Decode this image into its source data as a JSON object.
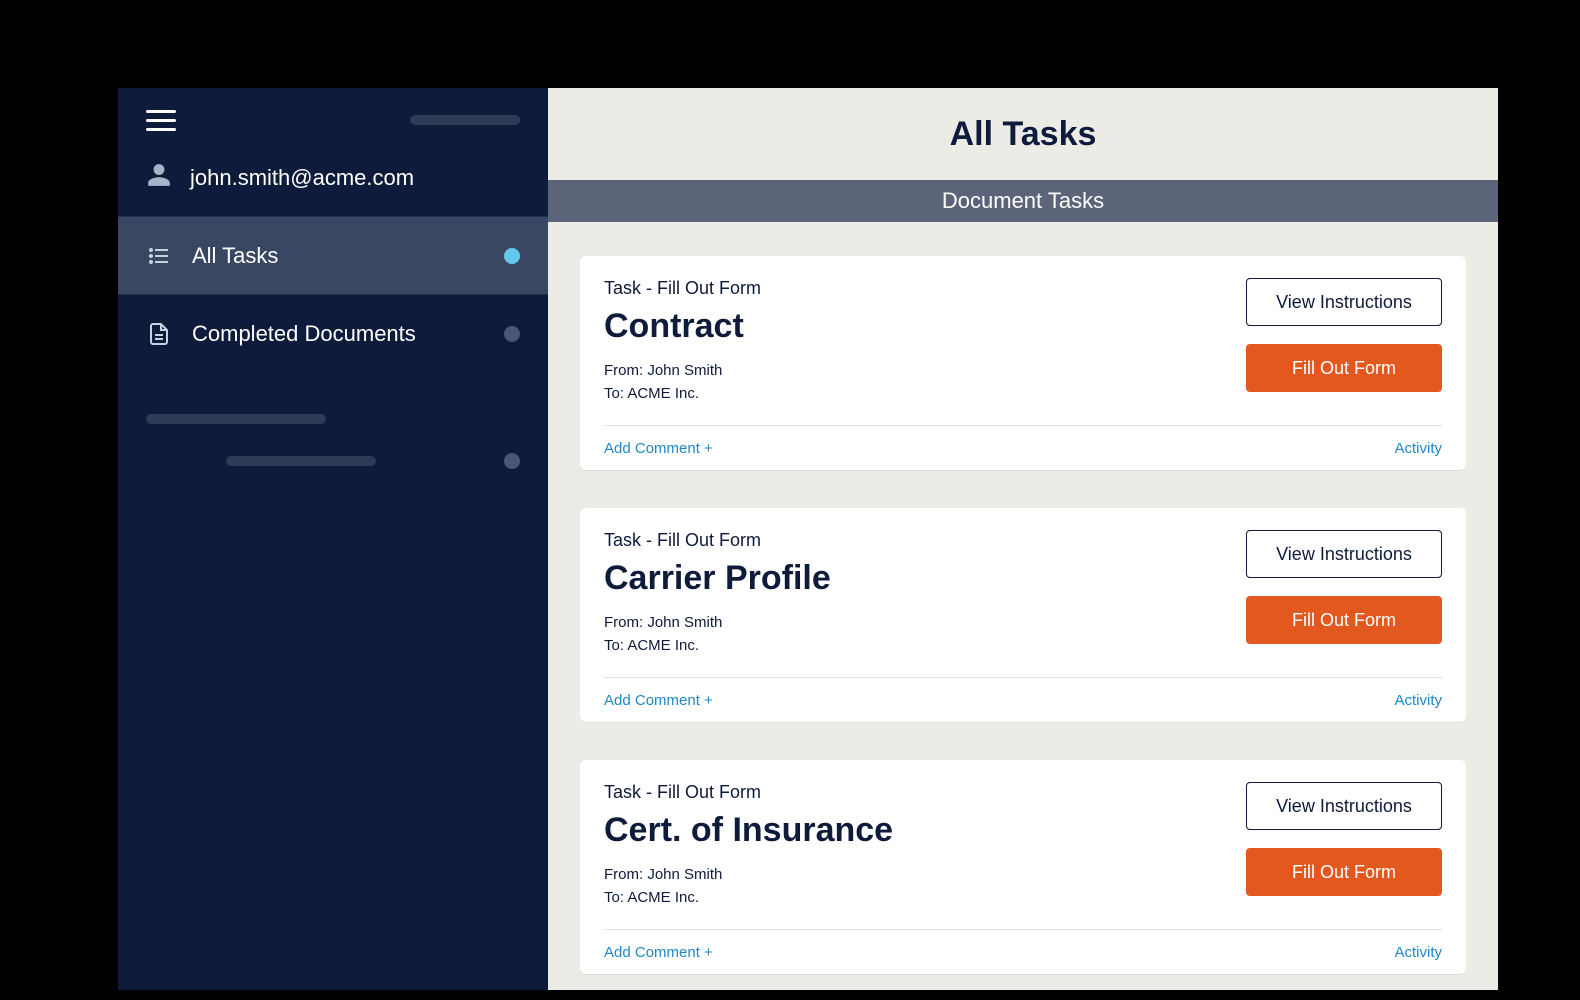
{
  "sidebar": {
    "user_email": "john.smith@acme.com",
    "items": [
      {
        "label": "All Tasks",
        "active": true,
        "dot": "blue"
      },
      {
        "label": "Completed Documents",
        "active": false,
        "dot": "gray"
      }
    ]
  },
  "main": {
    "title": "All Tasks",
    "section": "Document Tasks",
    "buttons": {
      "view_instructions": "View Instructions",
      "fill_out_form": "Fill Out Form"
    },
    "footer": {
      "add_comment": "Add Comment +",
      "activity": "Activity"
    },
    "tasks": [
      {
        "label": "Task - Fill Out Form",
        "title": "Contract",
        "from": "From: John Smith",
        "to": "To: ACME Inc."
      },
      {
        "label": "Task - Fill Out Form",
        "title": "Carrier Profile",
        "from": "From: John Smith",
        "to": "To: ACME Inc."
      },
      {
        "label": "Task - Fill Out Form",
        "title": "Cert. of Insurance",
        "from": "From: John Smith",
        "to": "To: ACME Inc."
      }
    ]
  }
}
